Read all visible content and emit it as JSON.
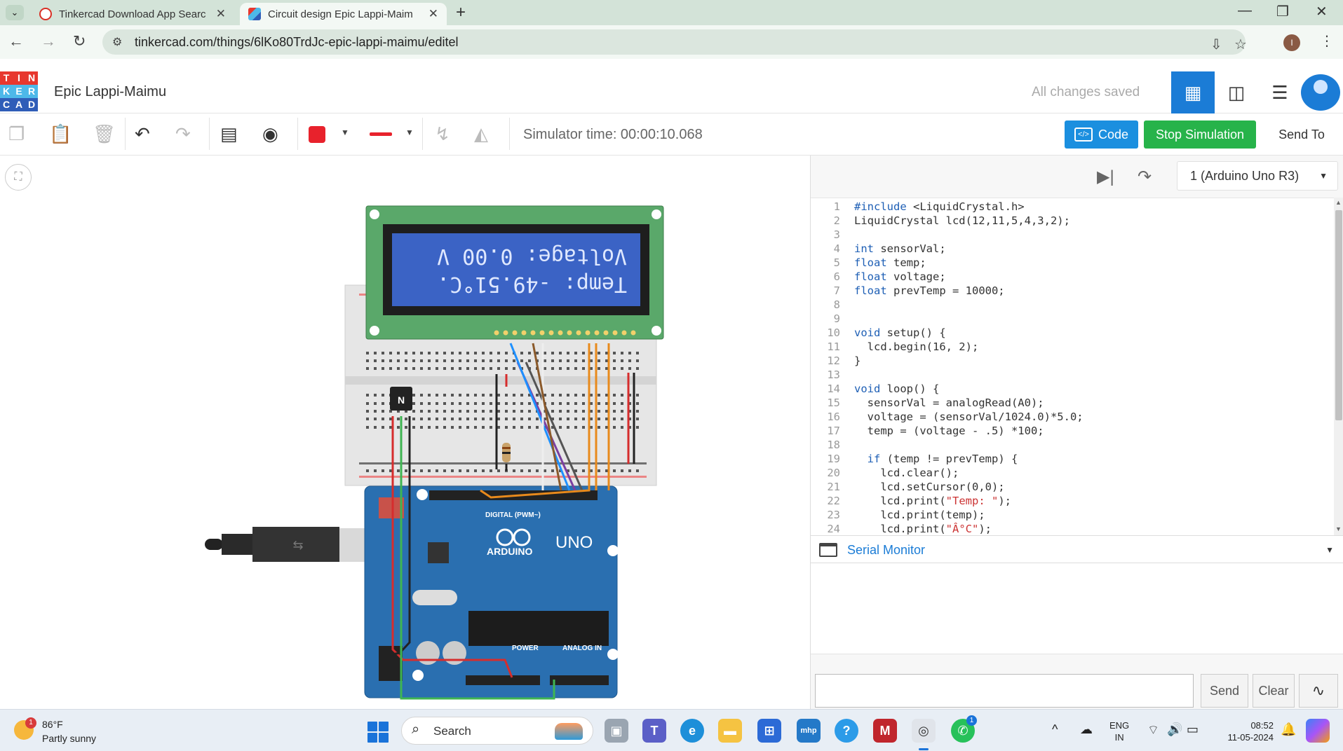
{
  "browser": {
    "tabs": [
      {
        "title": "Tinkercad Download App Searc",
        "favicon_color": "#d93025"
      },
      {
        "title": "Circuit design Epic Lappi-Maim",
        "favicon_color": "#e8a33b"
      }
    ],
    "url": "tinkercad.com/things/6lKo80TrdJc-epic-lappi-maimu/editel"
  },
  "header": {
    "logo_letters": [
      "T",
      "I",
      "N",
      "K",
      "E",
      "R",
      "C",
      "A",
      "D"
    ],
    "logo_colors": [
      "#e7372e",
      "#e7372e",
      "#e7372e",
      "#4db8e9",
      "#4db8e9",
      "#4db8e9",
      "#2f5db8",
      "#2f5db8",
      "#2f5db8"
    ],
    "project_title": "Epic Lappi-Maimu",
    "save_status": "All changes saved"
  },
  "toolbar": {
    "sim_time": "Simulator time: 00:00:10.068",
    "code_label": "Code",
    "stop_label": "Stop Simulation",
    "send_to_label": "Send To",
    "wire_color": "#e8222c"
  },
  "circuit": {
    "lcd_line1": "Temp: -49.51°C.",
    "lcd_line2": "Voltage: 0.00 V",
    "transistor_label": "N",
    "arduino_brand": "ARDUINO",
    "arduino_model": "UNO",
    "digital_label": "DIGITAL (PWM~)",
    "power_label": "POWER",
    "analog_label": "ANALOG IN"
  },
  "code_panel": {
    "board": "1 (Arduino Uno R3)",
    "serial_monitor_label": "Serial Monitor",
    "send_label": "Send",
    "clear_label": "Clear",
    "lines": [
      "#include <LiquidCrystal.h>",
      "LiquidCrystal lcd(12,11,5,4,3,2);",
      "",
      "int sensorVal;",
      "float temp;",
      "float voltage;",
      "float prevTemp = 10000;",
      "",
      "",
      "void setup() {",
      "  lcd.begin(16, 2);",
      "}",
      "",
      "void loop() {",
      "  sensorVal = analogRead(A0);",
      "  voltage = (sensorVal/1024.0)*5.0;",
      "  temp = (voltage - .5) *100;",
      "",
      "  if (temp != prevTemp) {",
      "    lcd.clear();",
      "    lcd.setCursor(0,0);",
      "    lcd.print(\"Temp: \");",
      "    lcd.print(temp);",
      "    lcd.print(\"Â°C\");"
    ]
  },
  "taskbar": {
    "weather_temp": "86°F",
    "weather_desc": "Partly sunny",
    "weather_badge": "1",
    "search_label": "Search",
    "lang_top": "ENG",
    "lang_bottom": "IN",
    "time": "08:52",
    "date": "11-05-2024",
    "whatsapp_badge": "1"
  }
}
